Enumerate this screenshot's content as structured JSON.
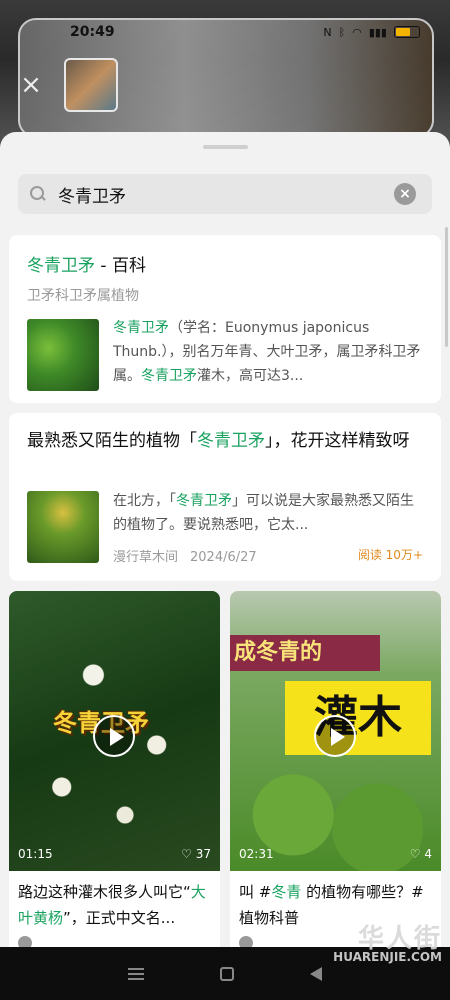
{
  "status_bar": {
    "time": "20:49",
    "icons": [
      "nfc-icon",
      "bluetooth-icon",
      "wifi-icon",
      "signal-icon",
      "battery-icon"
    ],
    "battery_color": "#f5b400"
  },
  "search": {
    "query": "冬青卫矛"
  },
  "results": {
    "card1": {
      "title_highlight": "冬青卫矛",
      "title_rest": " - 百科",
      "subtitle": "卫矛科卫矛属植物",
      "desc_a": "冬青卫矛",
      "desc_b": "（学名：Euonymus japonicus Thunb.），别名万年青、大叶卫矛，属卫矛科卫矛属。",
      "desc_c": "冬青卫矛",
      "desc_d": "灌木，高可达3..."
    },
    "card2": {
      "title_a": "最熟悉又陌生的植物「",
      "title_highlight": "冬青卫矛",
      "title_b": "」，花开这样精致呀",
      "desc_a": "在北方，「",
      "desc_highlight": "冬青卫矛",
      "desc_b": "」可以说是大家最熟悉又陌生的植物了。要说熟悉吧，它太...",
      "source": "漫行草木间",
      "date": "2024/6/27",
      "reads": "阅读 10万+"
    }
  },
  "videos": [
    {
      "cover_text": "冬青卫矛",
      "duration": "01:15",
      "likes": "37",
      "title_a": "路边这种灌木很多人叫它“",
      "title_highlight": "大叶黄杨",
      "title_b": "”，正式中文名..."
    },
    {
      "cover_banner": "成冬青的",
      "cover_big": "灌木",
      "duration": "02:31",
      "likes": "4",
      "title_a": "叫 #",
      "title_highlight": "冬青",
      "title_b": " 的植物有哪些？#植物科普"
    }
  ],
  "watermark": {
    "cn": "华人街",
    "en": "HUARENJIE.COM"
  },
  "colors": {
    "accent_green": "#1aa260",
    "reads_orange": "#e08a1e"
  }
}
